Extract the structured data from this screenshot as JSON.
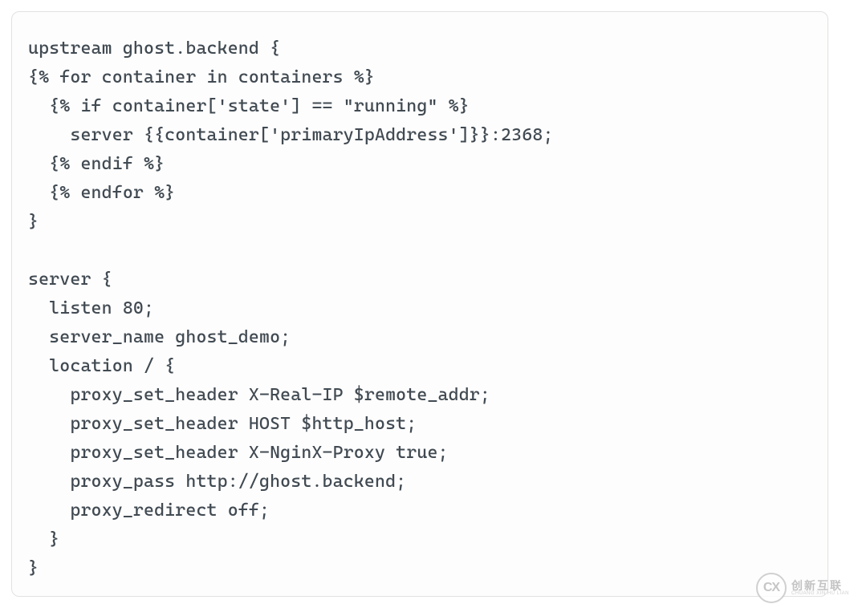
{
  "code": {
    "lines": [
      "upstream ghost.backend {",
      "{% for container in containers %}",
      "  {% if container['state'] == \"running\" %}",
      "    server {{container['primaryIpAddress']}}:2368;",
      "  {% endif %}",
      "  {% endfor %}",
      "}",
      "",
      "server {",
      "  listen 80;",
      "  server_name ghost_demo;",
      "  location / {",
      "    proxy_set_header X-Real-IP $remote_addr;",
      "    proxy_set_header HOST $http_host;",
      "    proxy_set_header X-NginX-Proxy true;",
      "    proxy_pass http://ghost.backend;",
      "    proxy_redirect off;",
      "  }",
      "}"
    ]
  },
  "watermark": {
    "logo_text": "CX",
    "main": "创新互联",
    "sub": "CHUANG XIN HU LIAN"
  }
}
